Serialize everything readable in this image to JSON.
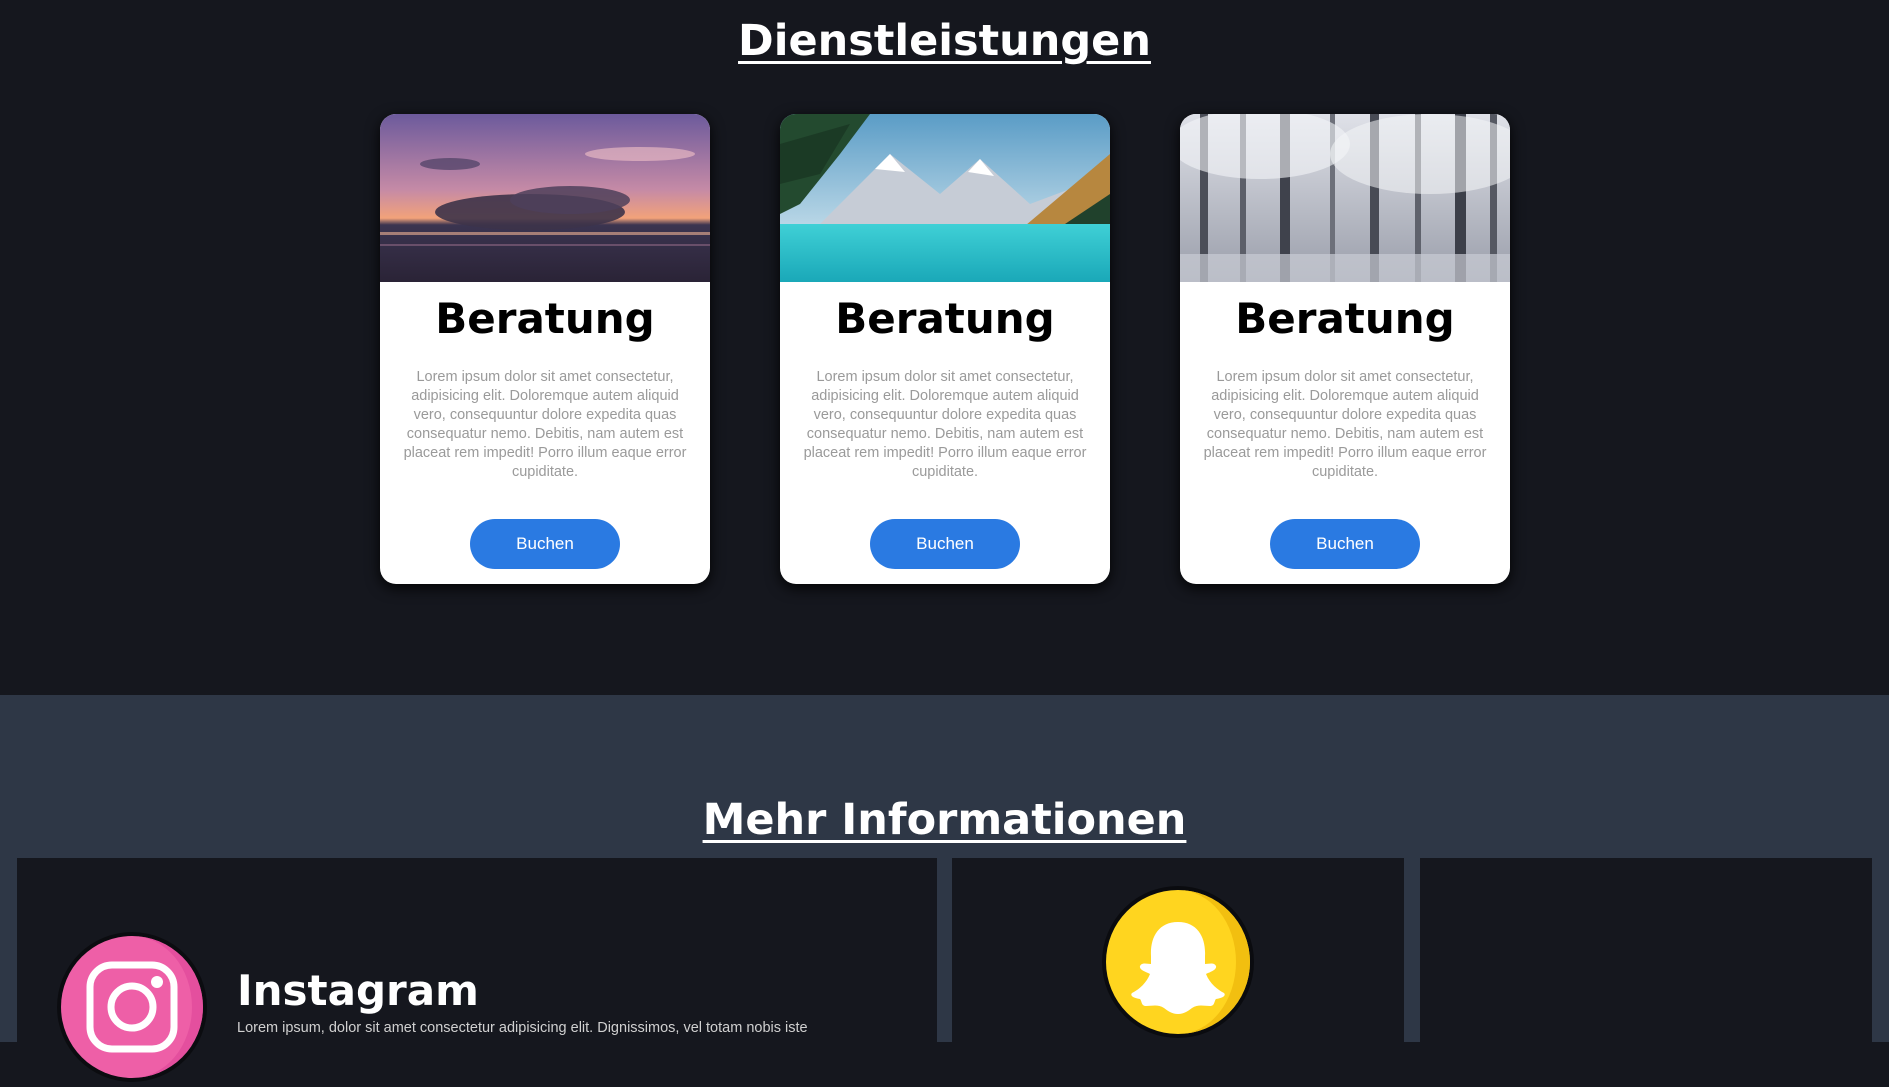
{
  "services": {
    "title": "Dienstleistungen",
    "cards": [
      {
        "image": "sunset-sea-photo",
        "title": "Beratung",
        "text": "Lorem ipsum dolor sit amet consectetur, adipisicing elit. Doloremque autem aliquid vero, consequuntur dolore expedita quas consequatur nemo. Debitis, nam autem est placeat rem impedit! Porro illum eaque error cupiditate.",
        "button": "Buchen"
      },
      {
        "image": "mountain-lake-photo",
        "title": "Beratung",
        "text": "Lorem ipsum dolor sit amet consectetur, adipisicing elit. Doloremque autem aliquid vero, consequuntur dolore expedita quas consequatur nemo. Debitis, nam autem est placeat rem impedit! Porro illum eaque error cupiditate.",
        "button": "Buchen"
      },
      {
        "image": "snowy-forest-photo",
        "title": "Beratung",
        "text": "Lorem ipsum dolor sit amet consectetur, adipisicing elit. Doloremque autem aliquid vero, consequuntur dolore expedita quas consequatur nemo. Debitis, nam autem est placeat rem impedit! Porro illum eaque error cupiditate.",
        "button": "Buchen"
      }
    ]
  },
  "info": {
    "title": "Mehr Informationen",
    "instagram": {
      "icon": "instagram-icon",
      "title": "Instagram",
      "text": "Lorem ipsum, dolor sit amet consectetur adipisicing elit. Dignissimos, vel totam nobis iste"
    },
    "snapchat": {
      "icon": "snapchat-icon"
    }
  },
  "colors": {
    "page_background": "#15171e",
    "info_background": "#2e3746",
    "button": "#2a7ae2",
    "card_text": "#9a9a9a",
    "instagram": "#ee5fa7",
    "snapchat": "#ffd51f"
  }
}
